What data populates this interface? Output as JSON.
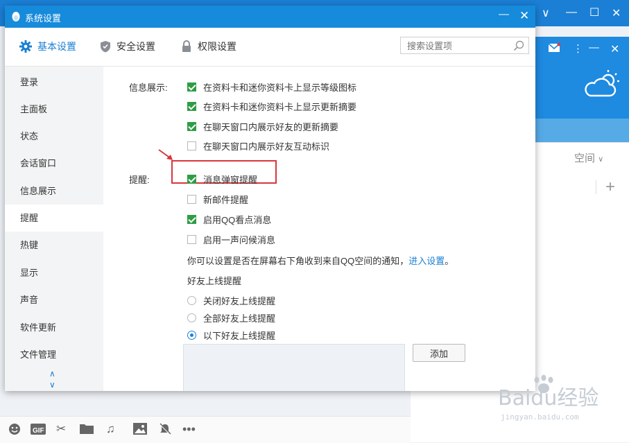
{
  "dialog": {
    "title": "系统设置",
    "tabs": [
      {
        "label": "基本设置",
        "icon": "gear-icon"
      },
      {
        "label": "安全设置",
        "icon": "shield-icon"
      },
      {
        "label": "权限设置",
        "icon": "lock-icon"
      }
    ],
    "search_placeholder": "搜索设置项",
    "sidebar": [
      "登录",
      "主面板",
      "状态",
      "会话窗口",
      "信息展示",
      "提醒",
      "热键",
      "显示",
      "声音",
      "软件更新",
      "文件管理"
    ],
    "sidebar_active": "提醒",
    "info_display": {
      "label": "信息展示:",
      "options": [
        {
          "text": "在资料卡和迷你资料卡上显示等级图标",
          "checked": true
        },
        {
          "text": "在资料卡和迷你资料卡上显示更新摘要",
          "checked": true
        },
        {
          "text": "在聊天窗口内展示好友的更新摘要",
          "checked": true
        },
        {
          "text": "在聊天窗口内展示好友互动标识",
          "checked": false
        }
      ]
    },
    "reminder": {
      "label": "提醒:",
      "options": [
        {
          "text": "消息弹窗提醒",
          "checked": true
        },
        {
          "text": "新邮件提醒",
          "checked": false
        },
        {
          "text": "启用QQ看点消息",
          "checked": true
        },
        {
          "text": "启用一声问候消息",
          "checked": false
        }
      ],
      "note": "你可以设置是否在屏幕右下角收到来自QQ空间的通知，",
      "note_link": "进入设置",
      "note_end": "。",
      "online_title": "好友上线提醒",
      "online_options": [
        {
          "text": "关闭好友上线提醒",
          "selected": false
        },
        {
          "text": "全部好友上线提醒",
          "selected": false
        },
        {
          "text": "以下好友上线提醒",
          "selected": true
        }
      ],
      "add_button": "添加"
    }
  },
  "background": {
    "space_tab": "空间",
    "plus": "+",
    "watermark_brand": "Baidu经验",
    "watermark_url": "jingyan.baidu.com"
  },
  "colors": {
    "accent": "#1b80d3",
    "title_bar": "#168adb",
    "check_green": "#2e9d44",
    "highlight_red": "#d9353b"
  }
}
